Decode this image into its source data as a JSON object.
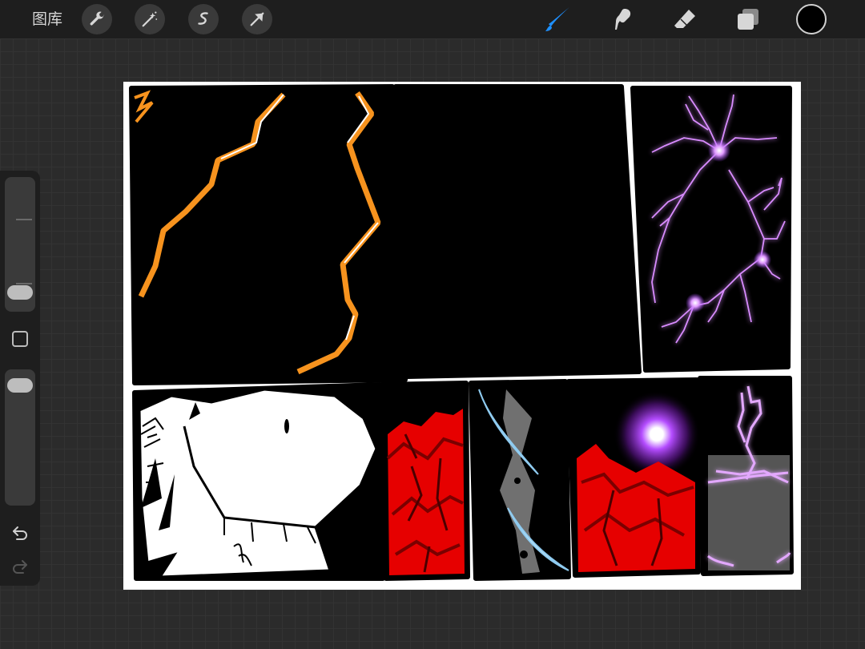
{
  "toolbar": {
    "gallery_label": "图库",
    "left_tools": [
      "wrench-icon",
      "magic-wand-icon",
      "selection-icon",
      "transform-arrow-icon"
    ],
    "right_tools": [
      "brush-icon",
      "smudge-icon",
      "eraser-icon",
      "layers-icon"
    ],
    "active_tool": "brush-icon",
    "active_color": "#000000",
    "accent_color": "#1e90ff"
  },
  "sidebar": {
    "brush_size": 0.08,
    "brush_opacity": 0.95,
    "icons": [
      "modify-square-icon",
      "undo-icon",
      "redo-icon"
    ]
  },
  "canvas": {
    "description_colors": {
      "lightning_orange": "#f7931e",
      "lightning_purple": "#c86bff",
      "flesh_red": "#e60000",
      "ice_blue": "#bfe8ff"
    }
  }
}
